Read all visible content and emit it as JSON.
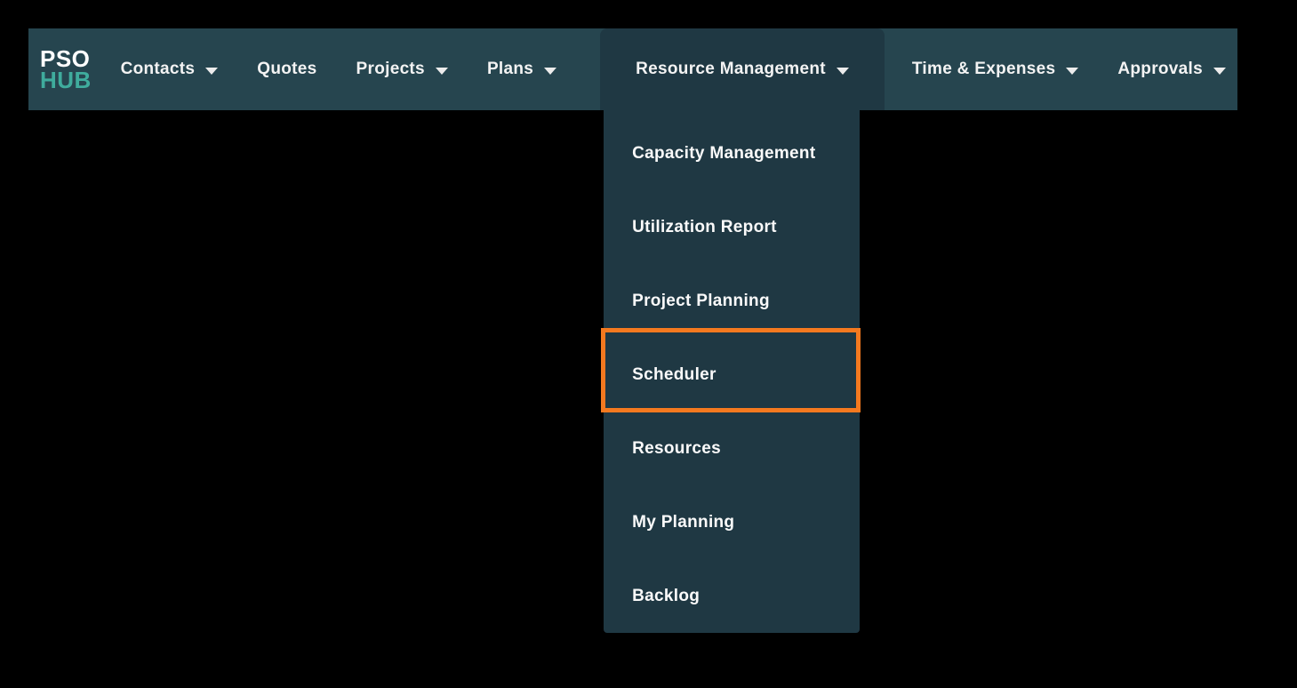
{
  "page": {
    "background": "#000000"
  },
  "navbar": {
    "background": "#26454f",
    "active_background": "#1f3843",
    "text_color": "#f3f3f3",
    "logo": {
      "line1": "PSO",
      "line2": "HUB",
      "line1_color": "#ffffff",
      "line2_color": "#3fac9d"
    },
    "items": [
      {
        "label": "Contacts",
        "has_dropdown": true,
        "active": false
      },
      {
        "label": "Quotes",
        "has_dropdown": false,
        "active": false
      },
      {
        "label": "Projects",
        "has_dropdown": true,
        "active": false
      },
      {
        "label": "Plans",
        "has_dropdown": true,
        "active": false
      },
      {
        "label": "Resource Management",
        "has_dropdown": true,
        "active": true
      },
      {
        "label": "Time & Expenses",
        "has_dropdown": true,
        "active": false
      },
      {
        "label": "Approvals",
        "has_dropdown": true,
        "active": false
      }
    ]
  },
  "dropdown": {
    "background": "#1f3843",
    "parent": "Resource Management",
    "highlight_color": "#f4791f",
    "items": [
      {
        "label": "Capacity Management",
        "highlighted": false
      },
      {
        "label": "Utilization Report",
        "highlighted": false
      },
      {
        "label": "Project Planning",
        "highlighted": false
      },
      {
        "label": "Scheduler",
        "highlighted": true
      },
      {
        "label": "Resources",
        "highlighted": false
      },
      {
        "label": "My Planning",
        "highlighted": false
      },
      {
        "label": "Backlog",
        "highlighted": false
      }
    ]
  }
}
